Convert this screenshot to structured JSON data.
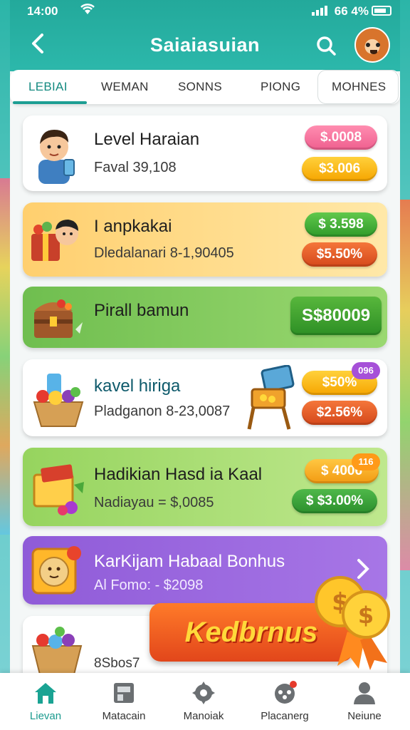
{
  "status_bar": {
    "time": "14:00",
    "battery": "66 4%"
  },
  "header": {
    "title": "Saiaiasuian"
  },
  "tabs": [
    {
      "label": "LEBIAI",
      "active": true
    },
    {
      "label": "WEMAN",
      "active": false
    },
    {
      "label": "SONNS",
      "active": false
    },
    {
      "label": "PIONG",
      "active": false
    },
    {
      "label": "MOHNES",
      "active": false
    }
  ],
  "cards": [
    {
      "title": "Level Haraian",
      "subtitle": "Faval 39,108",
      "pill_top": "$.0008",
      "pill_bottom": "$3.006",
      "bg": "#ffffff"
    },
    {
      "title": "I anpkakai",
      "subtitle": "Dledalanari 8-1,90405",
      "pill_top": "$ 3.598",
      "pill_bottom": "$5.50%",
      "bg": "#ffd87e"
    },
    {
      "title": "Pirall bamun",
      "pill_main": "S$80009",
      "bg": "#79c65a"
    },
    {
      "title": "kavel hiriga",
      "subtitle": "Pladganon 8-23,0087",
      "pill_top": "$50%",
      "pill_bottom": "$2.56%",
      "badge": "096",
      "bg": "#ffffff"
    },
    {
      "title": "Hadikian Hasd ia Kaal",
      "subtitle": "Nadiayau = $,0085",
      "pill_top": "$ 4006",
      "pill_bottom": "$ $3.00%",
      "badge": "116",
      "bg": "#a8dc6f"
    },
    {
      "title": "KarKijam Habaal Bonhus",
      "subtitle": "Al Fomo: - $2098",
      "bg": "#8b5ad4"
    },
    {
      "subtitle": "8Sbos7",
      "bg": "#ffffff"
    }
  ],
  "bonus_button": {
    "label": "Kedbrnus"
  },
  "bottom_nav": [
    {
      "label": "Lievan",
      "active": true
    },
    {
      "label": "Matacain",
      "active": false
    },
    {
      "label": "Manoiak",
      "active": false
    },
    {
      "label": "Placanerg",
      "active": false
    },
    {
      "label": "Neiune",
      "active": false
    }
  ],
  "colors": {
    "teal": "#23a99b",
    "pink": "#f3739b",
    "yellow": "#ffb81f",
    "green": "#3fae3a",
    "orange": "#e9671c",
    "purple": "#8b5ad4"
  }
}
